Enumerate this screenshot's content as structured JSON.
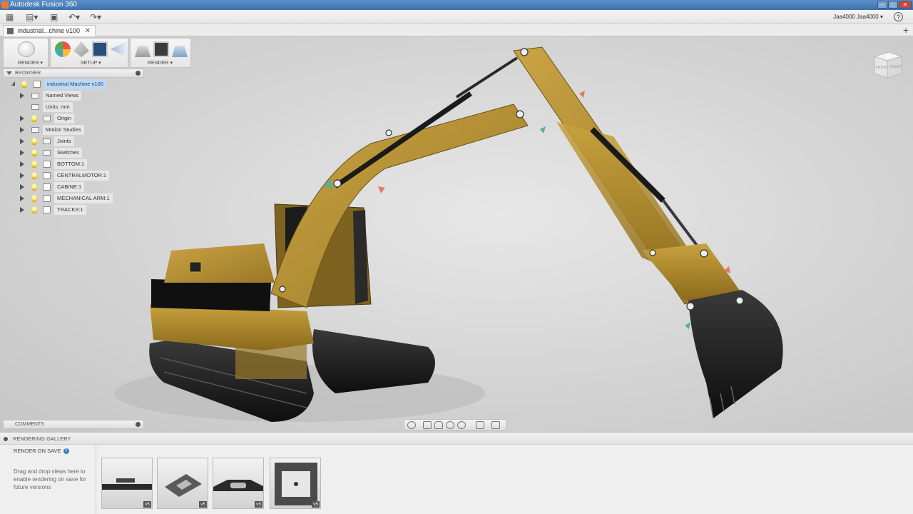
{
  "window": {
    "title": "Autodesk Fusion 360"
  },
  "qat": {
    "user": "Jaa4000 Jaa4000 ▾"
  },
  "tabs": [
    {
      "label": "industrial...chine v100"
    }
  ],
  "toolbar": {
    "render_workspace_label": "RENDER ▾",
    "setup_label": "SETUP ▾",
    "render_label": "RENDER ▾"
  },
  "browser": {
    "header": "BROWSER",
    "items": [
      {
        "label": "industrial Machine v100"
      },
      {
        "label": "Named Views"
      },
      {
        "label": "Units: mm"
      },
      {
        "label": "Origin"
      },
      {
        "label": "Motion Studies"
      },
      {
        "label": "Joints"
      },
      {
        "label": "Sketches"
      },
      {
        "label": "BOTTOM:1"
      },
      {
        "label": "CENTRALMOTOR:1"
      },
      {
        "label": "CABINE:1"
      },
      {
        "label": "MECHANICAL ARM:1"
      },
      {
        "label": "TRACKS:1"
      }
    ]
  },
  "comments": {
    "header": "COMMENTS"
  },
  "viewcube": {
    "front": "FRONT",
    "right": "RIGHT"
  },
  "gallery": {
    "header": "RENDERING GALLERY",
    "render_on_save": "RENDER ON SAVE",
    "hint": "Drag and drop views here to enable rendering on save for future versions",
    "thumbnails": [
      {
        "version": "v5"
      },
      {
        "version": "v5"
      },
      {
        "version": "v5"
      },
      {
        "version": "v5"
      }
    ]
  },
  "colors": {
    "accent": "#3a7fd0",
    "excavator_body": "#b08a2a",
    "selection": "#bcd8f5"
  }
}
